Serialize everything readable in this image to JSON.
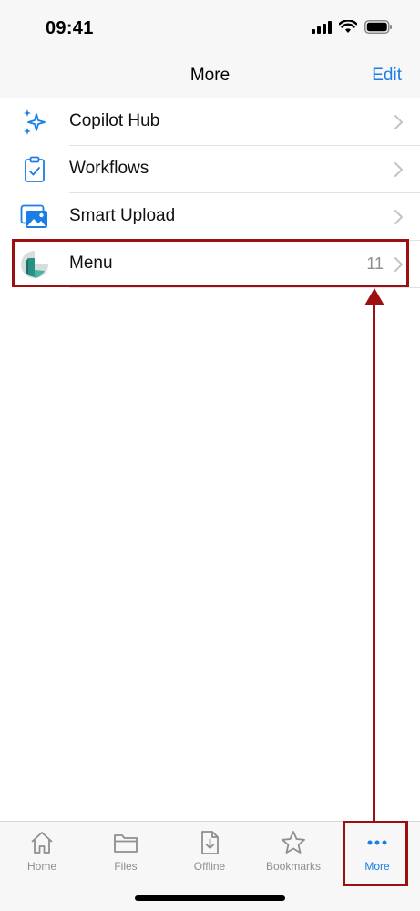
{
  "status_bar": {
    "time": "09:41"
  },
  "nav": {
    "title": "More",
    "edit_label": "Edit"
  },
  "list": {
    "items": [
      {
        "label": "Copilot Hub",
        "icon": "sparkle-icon",
        "count": ""
      },
      {
        "label": "Workflows",
        "icon": "clipboard-check-icon",
        "count": ""
      },
      {
        "label": "Smart Upload",
        "icon": "image-upload-icon",
        "count": ""
      },
      {
        "label": "Menu",
        "icon": "app-logo-icon",
        "count": "11"
      }
    ]
  },
  "tab_bar": {
    "tabs": [
      {
        "label": "Home",
        "icon": "home-icon",
        "active": false
      },
      {
        "label": "Files",
        "icon": "folder-icon",
        "active": false
      },
      {
        "label": "Offline",
        "icon": "download-doc-icon",
        "active": false
      },
      {
        "label": "Bookmarks",
        "icon": "star-icon",
        "active": false
      },
      {
        "label": "More",
        "icon": "more-dots-icon",
        "active": true
      }
    ]
  },
  "colors": {
    "accent": "#1a7ee6",
    "annotation": "#9b1010"
  }
}
